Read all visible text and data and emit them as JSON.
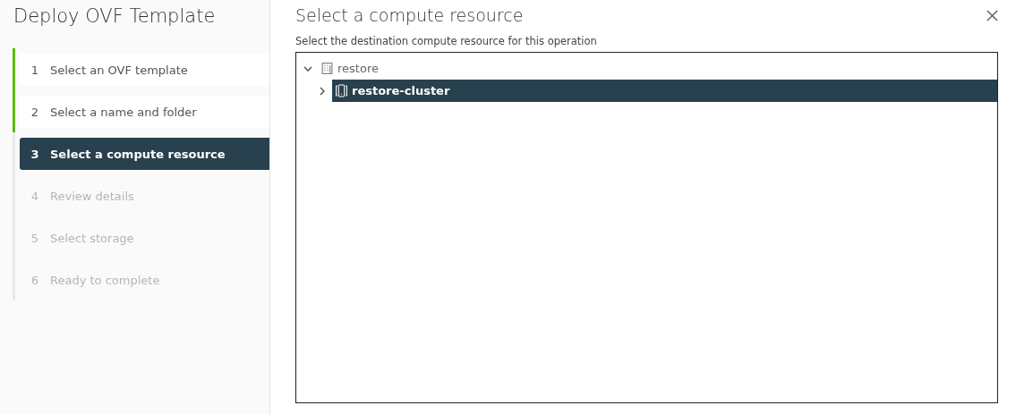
{
  "wizard": {
    "title": "Deploy OVF Template",
    "steps": [
      {
        "number": "1",
        "label": "Select an OVF template",
        "completed": true,
        "selected": false,
        "disabled": false
      },
      {
        "number": "2",
        "label": "Select a name and folder",
        "completed": true,
        "selected": false,
        "disabled": false
      },
      {
        "number": "3",
        "label": "Select a compute resource",
        "completed": false,
        "selected": true,
        "disabled": false
      },
      {
        "number": "4",
        "label": "Review details",
        "completed": false,
        "selected": false,
        "disabled": true
      },
      {
        "number": "5",
        "label": "Select storage",
        "completed": false,
        "selected": false,
        "disabled": true
      },
      {
        "number": "6",
        "label": "Ready to complete",
        "completed": false,
        "selected": false,
        "disabled": true
      }
    ]
  },
  "page": {
    "title": "Select a compute resource",
    "subtitle": "Select the destination compute resource for this operation",
    "tree": [
      {
        "label": "restore",
        "kind": "datacenter",
        "expanded": true,
        "selected": false,
        "children": [
          {
            "label": "restore-cluster",
            "kind": "cluster",
            "expanded": false,
            "selected": true
          }
        ]
      }
    ]
  }
}
